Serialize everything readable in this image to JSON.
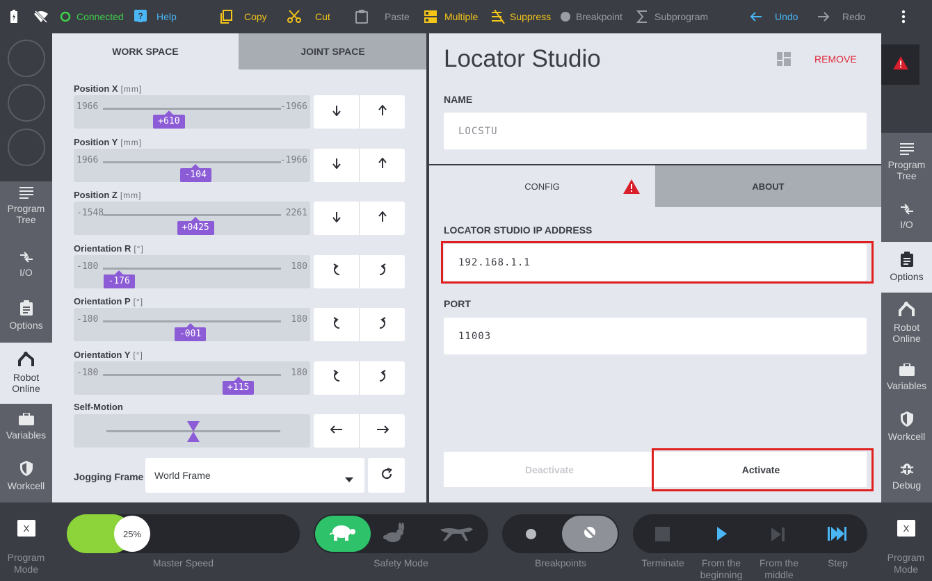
{
  "topbar": {
    "connected": "Connected",
    "help": "Help",
    "copy": "Copy",
    "cut": "Cut",
    "paste": "Paste",
    "multiple": "Multiple",
    "suppress": "Suppress",
    "breakpoint": "Breakpoint",
    "subprogram": "Subprogram",
    "undo": "Undo",
    "redo": "Redo"
  },
  "left_nav": [
    {
      "label": "Program Tree",
      "icon": "list-icon"
    },
    {
      "label": "I/O",
      "icon": "io-arrows-icon"
    },
    {
      "label": "Options",
      "icon": "clipboard-icon"
    },
    {
      "label": "Robot Online",
      "icon": "robot-arm-icon",
      "active": true
    },
    {
      "label": "Variables",
      "icon": "briefcase-icon"
    },
    {
      "label": "Workcell",
      "icon": "shield-icon"
    }
  ],
  "right_nav": [
    {
      "label": "Program Tree",
      "icon": "list-icon"
    },
    {
      "label": "I/O",
      "icon": "io-arrows-icon"
    },
    {
      "label": "Options",
      "icon": "clipboard-icon",
      "active": true
    },
    {
      "label": "Robot Online",
      "icon": "robot-arm-icon"
    },
    {
      "label": "Variables",
      "icon": "briefcase-icon"
    },
    {
      "label": "Workcell",
      "icon": "shield-icon"
    },
    {
      "label": "Debug",
      "icon": "bug-icon"
    }
  ],
  "jog": {
    "tabs": [
      "WORK SPACE",
      "JOINT SPACE"
    ],
    "sliders": [
      {
        "name": "Position X",
        "unit": "[mm]",
        "min": "1966",
        "max": "-1966",
        "value": "+610",
        "fraction": 0.37,
        "kind": "linear"
      },
      {
        "name": "Position Y",
        "unit": "[mm]",
        "min": "1966",
        "max": "-1966",
        "value": "-104",
        "fraction": 0.52,
        "kind": "linear"
      },
      {
        "name": "Position Z",
        "unit": "[mm]",
        "min": "-1548",
        "max": "2261",
        "value": "+0425",
        "fraction": 0.52,
        "kind": "linear"
      },
      {
        "name": "Orientation R",
        "unit": "[°]",
        "min": "-180",
        "max": "180",
        "value": "-176",
        "fraction": 0.09,
        "kind": "rotary"
      },
      {
        "name": "Orientation P",
        "unit": "[°]",
        "min": "-180",
        "max": "180",
        "value": "-001",
        "fraction": 0.49,
        "kind": "rotary"
      },
      {
        "name": "Orientation Y",
        "unit": "[°]",
        "min": "-180",
        "max": "180",
        "value": "+115",
        "fraction": 0.76,
        "kind": "rotary"
      }
    ],
    "self_motion": "Self-Motion",
    "self_motion_fraction": 0.5,
    "jogging_frame_label": "Jogging Frame",
    "jogging_frame_value": "World Frame"
  },
  "plugin": {
    "title": "Locator Studio",
    "remove": "REMOVE",
    "name_label": "NAME",
    "name_value": "LOCSTU",
    "tabs": [
      "CONFIG",
      "ABOUT"
    ],
    "ip_label": "LOCATOR STUDIO IP ADDRESS",
    "ip_value": "192.168.1.1",
    "port_label": "PORT",
    "port_value": "11003",
    "deactivate": "Deactivate",
    "activate": "Activate"
  },
  "bottombar": {
    "program_mode_left": "Program Mode",
    "program_mode_right": "Program Mode",
    "x_label": "X",
    "speed": "25%",
    "speed_fraction": 0.25,
    "master_speed": "Master Speed",
    "safety_mode": "Safety Mode",
    "breakpoints": "Breakpoints",
    "terminate": "Terminate",
    "from_beginning": "From the beginning",
    "from_middle": "From the middle",
    "step": "Step"
  },
  "colors": {
    "accent_purple": "#8b5cd6",
    "connected_green": "#3ecf4a",
    "toolbar_yellow": "#f5c518",
    "undo_blue": "#4ab6f5",
    "warning_red": "#d91f2c",
    "highlight_red": "#e01f1f"
  }
}
